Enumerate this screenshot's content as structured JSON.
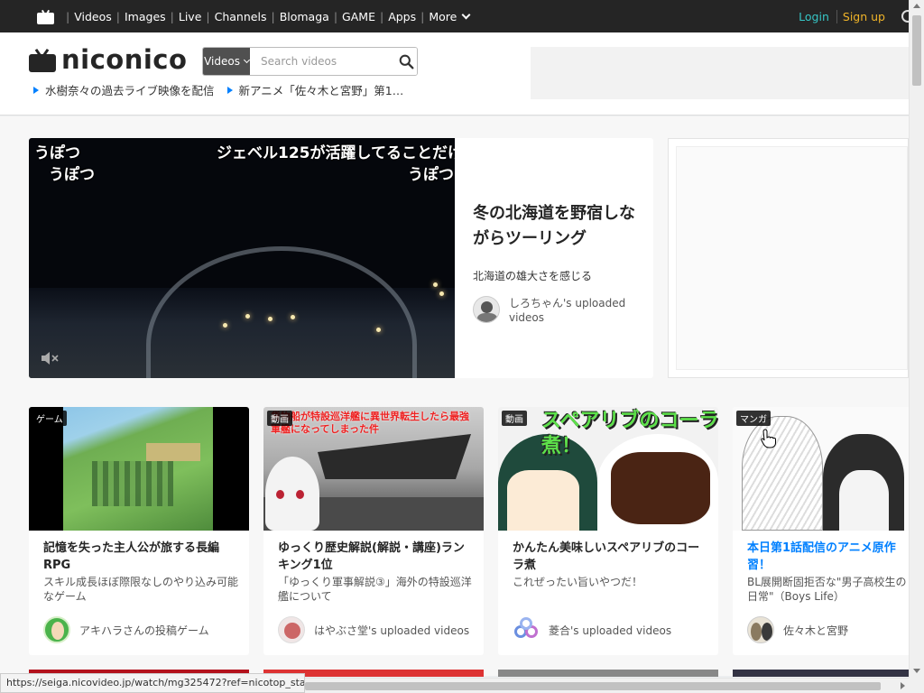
{
  "topnav": {
    "links": [
      "Videos",
      "Images",
      "Live",
      "Channels",
      "Blomaga",
      "GAME",
      "Apps"
    ],
    "more_label": "More",
    "login_label": "Login",
    "signup_label": "Sign up"
  },
  "header": {
    "brand": "niconico",
    "search_type": "Videos",
    "search_placeholder": "Search videos",
    "notices": [
      "水樹奈々の過去ライブ映像を配信",
      "新アニメ「佐々木と宮野」第1…"
    ]
  },
  "featured": {
    "comments": [
      "うぽつ",
      "うぽつ",
      "ジェベル125が活躍してることだけ",
      "うぽつ"
    ],
    "title": "冬の北海道を野宿しながらツーリング",
    "description": "北海道の雄大さを感じる",
    "uploader": "しろちゃん's uploaded videos"
  },
  "cards": [
    {
      "badge": "ゲーム",
      "title": "記憶を失った主人公が旅する長編RPG",
      "description": "スキル成長ほぼ際限なしのやり込み可能なゲーム",
      "uploader": "アキハラさんの投稿ゲーム",
      "title_color": "#252525"
    },
    {
      "badge": "動画",
      "thumb_text": "貨物船が特設巡洋艦に異世界転生したら最強軍艦になってしまった件",
      "title": "ゆっくり歴史解説(解説・講座)ランキング1位",
      "description": "「ゆっくり軍事解説③」海外の特設巡洋艦について",
      "uploader": "はやぶさ堂's uploaded videos",
      "title_color": "#252525"
    },
    {
      "badge": "動画",
      "thumb_text": "スペアリブのコーラ煮！",
      "title": "かんたん美味しいスペアリブのコーラ煮",
      "description": "これぜったい旨いやつだ！",
      "uploader": "菱合's uploaded videos",
      "title_color": "#252525"
    },
    {
      "badge": "マンガ",
      "title": "本日第1話配信のアニメ原作習！",
      "description": "BL展開断固拒否な\"男子高校生の日常\"（Boys Life）",
      "uploader": "佐々木と宮野",
      "title_color": "#0080ff"
    }
  ],
  "status_url": "https://seiga.nicovideo.jp/watch/mg325472?ref=nicotop_sta...",
  "colors": {
    "topbar": "#252525",
    "login": "#36c6c6",
    "signup": "#f0b429",
    "link_blue": "#0080ff"
  }
}
